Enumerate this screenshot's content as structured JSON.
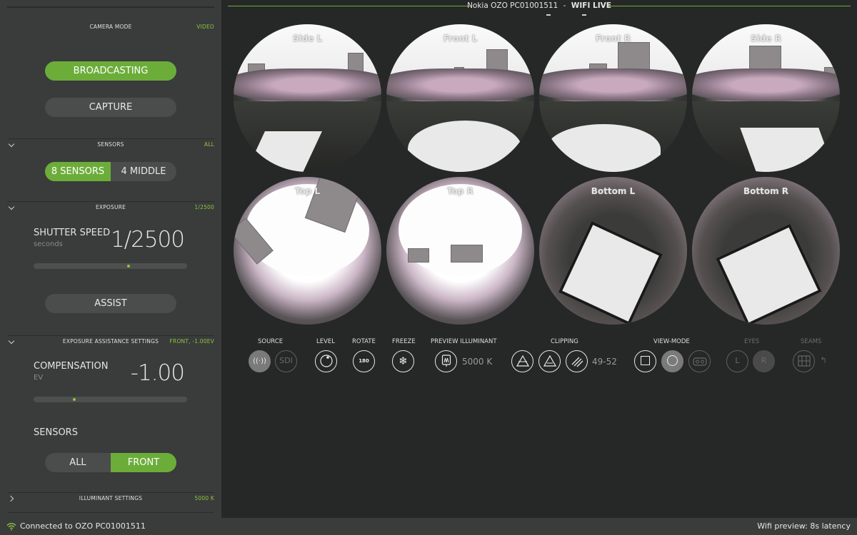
{
  "sidebar": {
    "camera_mode": {
      "title": "CAMERA MODE",
      "value": "VIDEO",
      "broadcasting": "BROADCASTING",
      "capture": "CAPTURE"
    },
    "sensors": {
      "title": "SENSORS",
      "value": "ALL",
      "opt1": "8 SENSORS",
      "opt2": "4 MIDDLE"
    },
    "exposure": {
      "title": "EXPOSURE",
      "value": "1/2500",
      "label": "SHUTTER SPEED",
      "unit": "seconds",
      "display": "1/2500",
      "slider_fraction": 0.62,
      "assist": "ASSIST"
    },
    "assist_settings": {
      "title": "EXPOSURE ASSISTANCE SETTINGS",
      "value": "FRONT, -1.00EV",
      "label": "COMPENSATION",
      "unit": "EV",
      "display": "-1.00",
      "slider_fraction": 0.26,
      "sensors_label": "SENSORS",
      "opt1": "ALL",
      "opt2": "FRONT"
    },
    "illuminant": {
      "title": "ILLUMINANT SETTINGS",
      "value": "5000 K"
    }
  },
  "header": {
    "device": "Nokia OZO PC01001511",
    "separator": "-",
    "mode": "WIFI LIVE"
  },
  "lenses": [
    {
      "label": "Side L"
    },
    {
      "label": "Front L"
    },
    {
      "label": "Front R"
    },
    {
      "label": "Side R"
    },
    {
      "label": "Top L"
    },
    {
      "label": "Top R"
    },
    {
      "label": "Bottom L"
    },
    {
      "label": "Bottom R"
    }
  ],
  "toolbar": {
    "source": "SOURCE",
    "sdi": "SDI",
    "level": "LEVEL",
    "rotate": "ROTATE",
    "rotate_value": "180",
    "freeze": "FREEZE",
    "preview_illuminant": "PREVIEW ILLUMINANT",
    "illuminant_value": "5000 K",
    "clipping": "CLIPPING",
    "clipping_value": "49-52",
    "view_mode": "VIEW-MODE",
    "eyes": "EYES",
    "eye_l": "L",
    "eye_r": "R",
    "seams": "SEAMS"
  },
  "status": {
    "left": "Connected to OZO PC01001511",
    "right": "Wifi preview: 8s latency"
  },
  "colors": {
    "accent": "#8cc63f",
    "button_green": "#6cad3a",
    "panel": "#3a3b3b",
    "background": "#262727"
  }
}
